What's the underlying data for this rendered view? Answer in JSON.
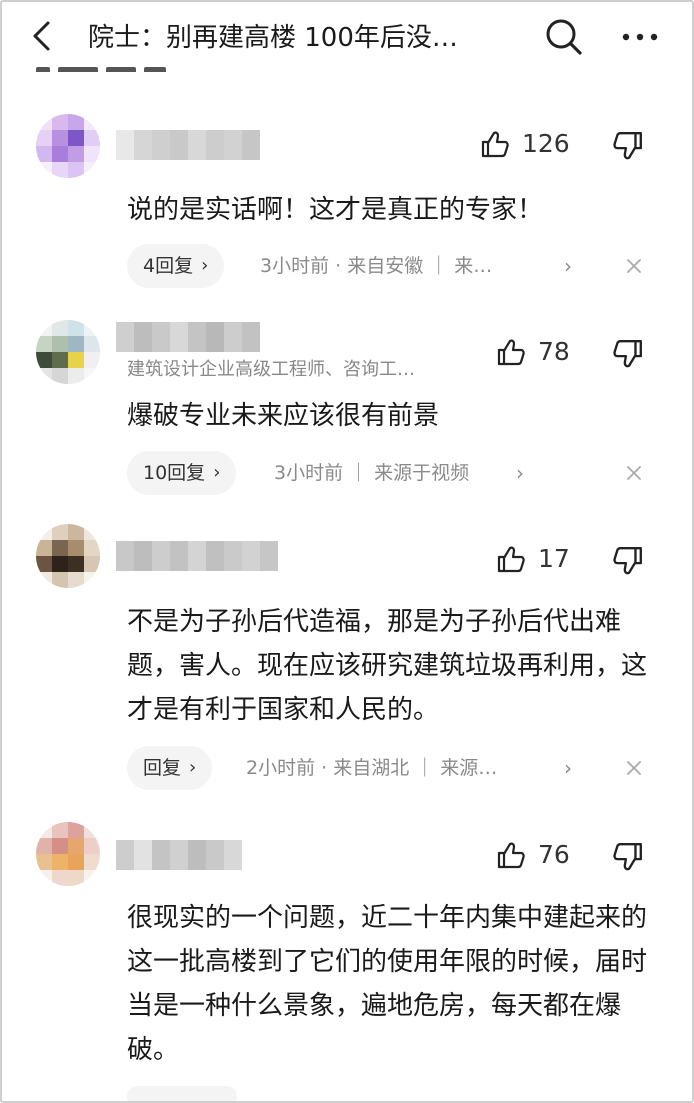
{
  "header": {
    "title": "院士：别再建高楼 100年后没…",
    "back_icon": "chevron-left-icon",
    "search_icon": "search-icon",
    "more_icon": "more-horizontal-icon"
  },
  "comments": [
    {
      "likes": "126",
      "content": "说的是实话啊！这才是真正的专家！",
      "reply_label": "4回复",
      "meta_text": "3小时前 · 来自安徽 ｜ 来…",
      "avatar_colors": [
        "#efe2f7",
        "#d9b8ee",
        "#c7a6ea",
        "#f3e9fa",
        "#e7d0f5",
        "#b790e0",
        "#7f56c8",
        "#e2cdf5",
        "#d2b7f0",
        "#a87ddc",
        "#c39ce6",
        "#efe4f8",
        "#f7f0fb",
        "#e8d6f6",
        "#dbc4f3",
        "#f5eefb"
      ],
      "username_colors": [
        "#e8e8e8",
        "#d6d6d6",
        "#cfcfcf",
        "#c9c9c9",
        "#d8d8d8",
        "#cdcdcd",
        "#d2d2d2",
        "#c6c6c6"
      ]
    },
    {
      "likes": "78",
      "user_title": "建筑设计企业高级工程师、咨询工…",
      "content": "爆破专业未来应该很有前景",
      "reply_label": "10回复",
      "meta_text": "3小时前 ｜ 来源于视频",
      "avatar_colors": [
        "#f2f4f2",
        "#dfe8e6",
        "#cfe2e8",
        "#eef3f5",
        "#c7d3c3",
        "#aebfad",
        "#9fb7c3",
        "#dde6ea",
        "#3e4a3a",
        "#5f6d4f",
        "#e8d24a",
        "#f0f0f0",
        "#e4e4e4",
        "#d6d6d6",
        "#ececec",
        "#f6f6f6"
      ],
      "username_colors": [
        "#cfcfcf",
        "#bdbdbd",
        "#c9c9c9",
        "#d8d8d8",
        "#c4c4c4",
        "#b8b8b8",
        "#cdcdcd",
        "#c2c2c2"
      ]
    },
    {
      "likes": "17",
      "content": "不是为子孙后代造福，那是为子孙后代出难题，害人。现在应该研究建筑垃圾再利用，这才是有利于国家和人民的。",
      "reply_label": "回复",
      "meta_text": "2小时前 · 来自湖北 ｜ 来源…",
      "avatar_colors": [
        "#f4efe8",
        "#ddd0bf",
        "#cbb79f",
        "#efe7dc",
        "#c9b497",
        "#7a6550",
        "#a88d6d",
        "#e3d6c5",
        "#6b5440",
        "#2e231a",
        "#3c2f24",
        "#d7c7b2",
        "#efe9e1",
        "#d4c5b1",
        "#e6dccd",
        "#f6f2ec"
      ],
      "username_colors": [
        "#c8c8c8",
        "#bdbdbd",
        "#cdcdcd",
        "#c2c2c2",
        "#d4d4d4",
        "#c0c0c0",
        "#cacaca",
        "#d2d2d2",
        "#c6c6c6"
      ]
    },
    {
      "likes": "76",
      "content": "很现实的一个问题，近二十年内集中建起来的这一批高楼到了它们的使用年限的时候，届时当是一种什么景象，遍地危房，每天都在爆破。",
      "avatar_colors": [
        "#f5e8e6",
        "#e9c4bf",
        "#dba39c",
        "#f2dedb",
        "#e2b2a8",
        "#d48f86",
        "#e6a76f",
        "#edcfc7",
        "#e9c090",
        "#edb368",
        "#e7a45a",
        "#f0dccf",
        "#f7efea",
        "#efd7cd",
        "#eed9c8",
        "#f8f1ec"
      ],
      "username_colors": [
        "#cdcdcd",
        "#e2e2e2",
        "#c4c4c4",
        "#d0d0d0",
        "#bdbdbd",
        "#c9c9c9",
        "#d8d8d8"
      ]
    }
  ],
  "colors": {
    "text": "#1a1a1a",
    "muted": "#8a8a8a",
    "pill_bg": "#f4f4f4"
  }
}
